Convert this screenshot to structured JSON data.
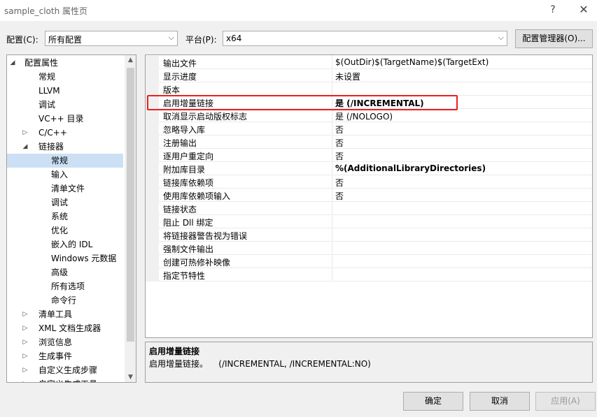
{
  "window": {
    "title": "sample_cloth 属性页",
    "help_icon": "?",
    "close_icon": "✕"
  },
  "toolbar": {
    "config_label": "配置(C):",
    "config_value": "所有配置",
    "platform_label": "平台(P):",
    "platform_value": "x64",
    "config_manager_button": "配置管理器(O)..."
  },
  "tree": {
    "items": [
      {
        "label": "配置属性",
        "expander": "◢",
        "level": 0
      },
      {
        "label": "常规",
        "level": 1
      },
      {
        "label": "LLVM",
        "level": 1
      },
      {
        "label": "调试",
        "level": 1
      },
      {
        "label": "VC++ 目录",
        "level": 1
      },
      {
        "label": "C/C++",
        "expander": "▷",
        "level": 1
      },
      {
        "label": "链接器",
        "expander": "◢",
        "level": 1
      },
      {
        "label": "常规",
        "level": 2,
        "selected": true
      },
      {
        "label": "输入",
        "level": 2
      },
      {
        "label": "清单文件",
        "level": 2
      },
      {
        "label": "调试",
        "level": 2
      },
      {
        "label": "系统",
        "level": 2
      },
      {
        "label": "优化",
        "level": 2
      },
      {
        "label": "嵌入的 IDL",
        "level": 2
      },
      {
        "label": "Windows 元数据",
        "level": 2
      },
      {
        "label": "高级",
        "level": 2
      },
      {
        "label": "所有选项",
        "level": 2
      },
      {
        "label": "命令行",
        "level": 2
      },
      {
        "label": "清单工具",
        "expander": "▷",
        "level": 1
      },
      {
        "label": "XML 文档生成器",
        "expander": "▷",
        "level": 1
      },
      {
        "label": "浏览信息",
        "expander": "▷",
        "level": 1
      },
      {
        "label": "生成事件",
        "expander": "▷",
        "level": 1
      },
      {
        "label": "自定义生成步骤",
        "expander": "▷",
        "level": 1
      },
      {
        "label": "自定义生成工具",
        "expander": "▷",
        "level": 1
      }
    ]
  },
  "grid": {
    "rows": [
      {
        "name": "输出文件",
        "value": "$(OutDir)$(TargetName)$(TargetExt)",
        "bold": false
      },
      {
        "name": "显示进度",
        "value": "未设置",
        "bold": false
      },
      {
        "name": "版本",
        "value": "",
        "bold": false
      },
      {
        "name": "启用增量链接",
        "value": "是 (/INCREMENTAL)",
        "bold": true
      },
      {
        "name": "取消显示启动版权标志",
        "value": "是 (/NOLOGO)",
        "bold": false
      },
      {
        "name": "忽略导入库",
        "value": "否",
        "bold": false
      },
      {
        "name": "注册输出",
        "value": "否",
        "bold": false
      },
      {
        "name": "逐用户重定向",
        "value": "否",
        "bold": false
      },
      {
        "name": "附加库目录",
        "value": "%(AdditionalLibraryDirectories)",
        "bold": true
      },
      {
        "name": "链接库依赖项",
        "value": "否",
        "bold": false
      },
      {
        "name": "使用库依赖项输入",
        "value": "否",
        "bold": false
      },
      {
        "name": "链接状态",
        "value": "",
        "bold": false
      },
      {
        "name": "阻止 Dll 绑定",
        "value": "",
        "bold": false
      },
      {
        "name": "将链接器警告视为错误",
        "value": "",
        "bold": false
      },
      {
        "name": "强制文件输出",
        "value": "",
        "bold": false
      },
      {
        "name": "创建可热修补映像",
        "value": "",
        "bold": false
      },
      {
        "name": "指定节特性",
        "value": "",
        "bold": false
      }
    ]
  },
  "description": {
    "title": "启用增量链接",
    "text": "启用增量链接。    (/INCREMENTAL, /INCREMENTAL:NO)"
  },
  "buttons": {
    "ok": "确定",
    "cancel": "取消",
    "apply": "应用(A)"
  },
  "colors": {
    "highlight_box": "#e82020",
    "selected_tree_item": "#cce0f5"
  }
}
